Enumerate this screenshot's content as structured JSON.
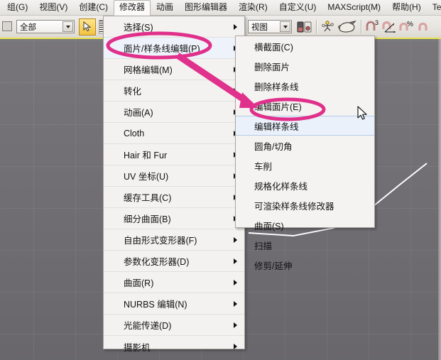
{
  "menubar": {
    "items": [
      {
        "label": "组(G)",
        "active": false
      },
      {
        "label": "视图(V)",
        "active": false
      },
      {
        "label": "创建(C)",
        "active": false
      },
      {
        "label": "修改器",
        "active": true
      },
      {
        "label": "动画",
        "active": false
      },
      {
        "label": "图形编辑器",
        "active": false
      },
      {
        "label": "渲染(R)",
        "active": false
      },
      {
        "label": "自定义(U)",
        "active": false
      },
      {
        "label": "MAXScript(M)",
        "active": false
      },
      {
        "label": "帮助(H)",
        "active": false
      },
      {
        "label": "Tentac",
        "active": false
      }
    ]
  },
  "toolbar": {
    "selection_filter_value": "全部",
    "view_combo_value": "视图",
    "icons": [
      "select-object-icon",
      "hatch-grip-icon",
      "mirror-icon",
      "align-icon",
      "render-setup-icon",
      "snaps-toggle-icon",
      "angle-snap-icon",
      "percent-snap-icon",
      "spinner-snap-icon"
    ],
    "snap_badge": "3",
    "percent_badge": "%"
  },
  "modifiers_menu": {
    "items": [
      {
        "label": "选择(S)",
        "submenu": true,
        "highlight": false
      },
      {
        "label": "面片/样条线编辑(P)",
        "submenu": true,
        "highlight": true
      },
      {
        "label": "网格编辑(M)",
        "submenu": true,
        "highlight": false
      },
      {
        "label": "转化",
        "submenu": true,
        "highlight": false
      },
      {
        "label": "动画(A)",
        "submenu": true,
        "highlight": false
      },
      {
        "label": "Cloth",
        "submenu": true,
        "highlight": false
      },
      {
        "label": "Hair 和 Fur",
        "submenu": true,
        "highlight": false
      },
      {
        "label": "UV 坐标(U)",
        "submenu": true,
        "highlight": false
      },
      {
        "label": "缓存工具(C)",
        "submenu": true,
        "highlight": false
      },
      {
        "label": "细分曲面(B)",
        "submenu": true,
        "highlight": false
      },
      {
        "label": "自由形式变形器(F)",
        "submenu": true,
        "highlight": false
      },
      {
        "label": "参数化变形器(D)",
        "submenu": true,
        "highlight": false
      },
      {
        "label": "曲面(R)",
        "submenu": true,
        "highlight": false
      },
      {
        "label": "NURBS 编辑(N)",
        "submenu": true,
        "highlight": false
      },
      {
        "label": "光能传递(D)",
        "submenu": true,
        "highlight": false
      },
      {
        "label": "摄影机",
        "submenu": true,
        "highlight": false
      }
    ]
  },
  "patch_spline_submenu": {
    "items": [
      {
        "label": "横截面(C)",
        "highlight": false
      },
      {
        "label": "删除面片",
        "highlight": false
      },
      {
        "label": "删除样条线",
        "highlight": false
      },
      {
        "label": "编辑面片(E)",
        "highlight": false
      },
      {
        "label": "编辑样条线",
        "highlight": true
      },
      {
        "label": "圆角/切角",
        "highlight": false
      },
      {
        "label": "车削",
        "highlight": false
      },
      {
        "label": "规格化样条线",
        "highlight": false
      },
      {
        "label": "可渲染样条线修改器",
        "highlight": false
      },
      {
        "label": "曲面(S)",
        "highlight": false
      },
      {
        "label": "扫描",
        "highlight": false
      },
      {
        "label": "修剪/延伸",
        "highlight": false
      }
    ]
  },
  "annotations": {
    "highlight_color": "#e0308b",
    "arrow_color": "#e0318c",
    "ring1_target": "面片/样条线编辑(P)",
    "ring2_target": "编辑样条线"
  },
  "viewport": {
    "background_color": "#6f6d72",
    "spline_color": "#ffffff",
    "spline_name": "spline-curve"
  },
  "cursor": {
    "name": "mouse-pointer"
  }
}
